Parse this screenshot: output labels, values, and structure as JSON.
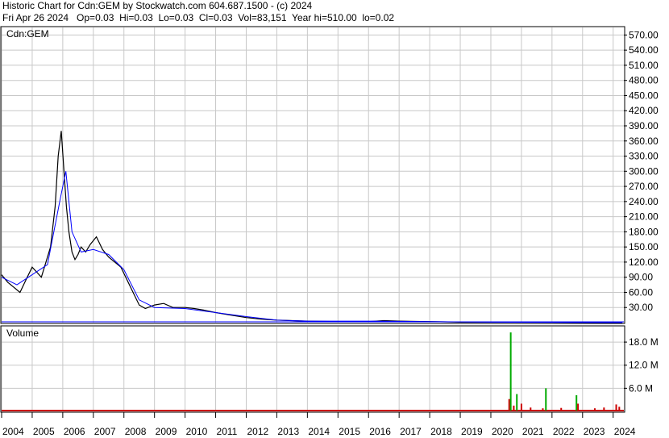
{
  "header": {
    "line1": "Historic Chart for Cdn:GEM by Stockwatch.com 604.687.1500 - (c) 2024",
    "line2": "Fri Apr 26 2024   Op=0.03  Hi=0.03  Lo=0.03  Cl=0.03  Vol=83,151  Year hi=510.00  lo=0.02"
  },
  "colors": {
    "grid": "#c8c8c8",
    "frame": "#000000",
    "price": "#000000",
    "ma_short": "#ff00ff",
    "ma_long": "#0000ff",
    "volume": "#cc0000",
    "volume_spike": "#00aa00",
    "baseline": "#00aa00"
  },
  "chart_data": [
    {
      "type": "line",
      "title": "Cdn:GEM",
      "ylim": [
        0,
        585
      ],
      "y_ticks": [
        "30.00",
        "60.00",
        "90.00",
        "120.00",
        "150.00",
        "180.00",
        "210.00",
        "240.00",
        "270.00",
        "300.00",
        "330.00",
        "360.00",
        "390.00",
        "420.00",
        "450.00",
        "480.00",
        "510.00",
        "540.00",
        "570.00"
      ],
      "x_labels": [
        "2004",
        "2005",
        "2006",
        "2007",
        "2008",
        "2009",
        "2010",
        "2011",
        "2012",
        "2013",
        "2014",
        "2015",
        "2016",
        "2017",
        "2018",
        "2019",
        "2020",
        "2021",
        "2022",
        "2023",
        "2024"
      ],
      "xlim": [
        2004.0,
        2024.35
      ],
      "series": [
        {
          "x": [
            2004.0,
            2004.2,
            2004.4,
            2004.6,
            2004.8,
            2005.0,
            2005.15,
            2005.3,
            2005.45,
            2005.6,
            2005.75,
            2005.85,
            2005.95,
            2006.05,
            2006.12,
            2006.2,
            2006.3,
            2006.4,
            2006.5,
            2006.6,
            2006.75,
            2006.9,
            2007.1,
            2007.3,
            2007.5,
            2007.7,
            2007.9,
            2008.1,
            2008.3,
            2008.5,
            2008.7,
            2009.0,
            2009.3,
            2009.6,
            2010.0,
            2010.3,
            2010.6,
            2011.0,
            2011.5,
            2012.0,
            2012.5,
            2013.0,
            2014.0,
            2015.0,
            2016.0,
            2016.5,
            2017.0,
            2018.0,
            2019.0,
            2020.0,
            2021.0,
            2022.0,
            2023.0,
            2024.3
          ],
          "values": [
            95,
            80,
            70,
            60,
            85,
            110,
            100,
            90,
            120,
            150,
            230,
            330,
            380,
            290,
            230,
            180,
            140,
            125,
            135,
            150,
            140,
            155,
            170,
            145,
            130,
            120,
            110,
            85,
            60,
            35,
            28,
            35,
            38,
            30,
            30,
            28,
            25,
            20,
            15,
            10,
            7,
            5,
            3,
            2,
            2,
            4,
            3,
            2,
            1,
            1,
            1,
            1,
            0.5,
            0.03
          ]
        },
        {
          "x": [
            2004.0,
            2004.5,
            2005.0,
            2005.5,
            2005.9,
            2006.1,
            2006.3,
            2006.6,
            2007.0,
            2007.5,
            2008.0,
            2008.5,
            2009.0,
            2010.0,
            2011.0,
            2012.0,
            2013.0,
            2014.0,
            2016.0,
            2018.0,
            2020.0,
            2024.3
          ],
          "values": [
            90,
            75,
            95,
            115,
            240,
            300,
            180,
            140,
            145,
            135,
            105,
            45,
            30,
            28,
            20,
            12,
            5,
            3,
            3,
            2,
            1,
            0.1
          ]
        }
      ]
    },
    {
      "type": "bar",
      "title": "Volume",
      "y_ticks": [
        "6.0 M",
        "12.0 M",
        "18.0 M"
      ],
      "ylim": [
        0,
        22
      ],
      "bars": [
        {
          "x": 2020.6,
          "value": 3.2
        },
        {
          "x": 2020.65,
          "value": 20.5
        },
        {
          "x": 2020.75,
          "value": 1.5
        },
        {
          "x": 2020.85,
          "value": 4.5
        },
        {
          "x": 2021.0,
          "value": 2.0
        },
        {
          "x": 2021.3,
          "value": 1.0
        },
        {
          "x": 2021.7,
          "value": 0.8
        },
        {
          "x": 2021.8,
          "value": 6.0
        },
        {
          "x": 2022.3,
          "value": 0.9
        },
        {
          "x": 2022.8,
          "value": 4.2
        },
        {
          "x": 2022.85,
          "value": 2.0
        },
        {
          "x": 2023.4,
          "value": 0.8
        },
        {
          "x": 2023.7,
          "value": 1.0
        },
        {
          "x": 2024.1,
          "value": 1.8
        },
        {
          "x": 2024.2,
          "value": 1.2
        }
      ]
    }
  ]
}
